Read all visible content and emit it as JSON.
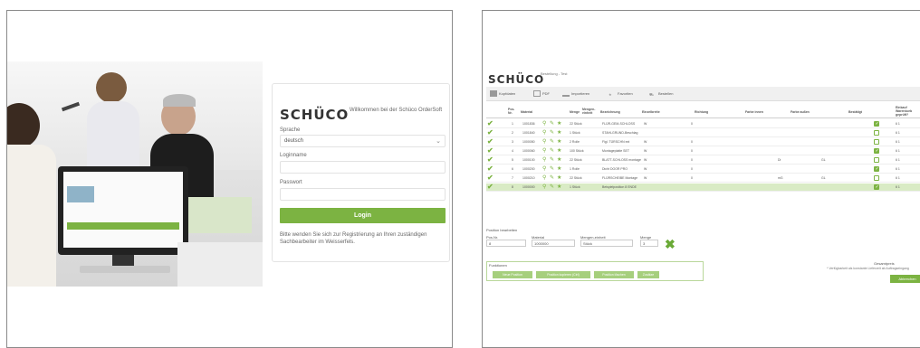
{
  "login": {
    "logo": "SCHÜCO",
    "welcome": "Willkommen bei der Schüco OrderSoft",
    "language_label": "Sprache",
    "language_value": "deutsch",
    "username_label": "Loginname",
    "password_label": "Passwort",
    "login_button": "Login",
    "help_text": "Bitte wenden Sie sich zur Registrierung an Ihren zuständigen Sachbearbeiter im Weisserfels.",
    "photo_caption": "Teammeeting am Bildschirm"
  },
  "order": {
    "logo": "SCHÜCO",
    "subtitle": "Bestellung - Test",
    "toolbar": [
      "Kopfdaten",
      "PDF",
      "Importieren",
      "Favoriten",
      "Bestellen"
    ],
    "columns": [
      "Pos. Nr.",
      "Material",
      "Menge",
      "Mengen-einheit",
      "Bezeichnung",
      "Einzelbreite",
      "Richtung",
      "Farbe innen",
      "Farbe außen",
      "Bestätigt",
      "Einkauf Warenkorb geprüft?"
    ],
    "rows": [
      {
        "pos": "1",
        "material": "1001836",
        "qty": "22 Stück",
        "desc": "FLÜR-GEM-SCHLOSS",
        "b": "W",
        "c": "0",
        "d": "",
        "e": "",
        "checked": true,
        "end": "6 1"
      },
      {
        "pos": "2",
        "material": "1001840",
        "qty": "1 Stück",
        "desc": "STAHLGRUND-Beschlag",
        "b": "",
        "c": "",
        "d": "",
        "e": "",
        "checked": false,
        "end": "6 1"
      },
      {
        "pos": "3",
        "material": "1000050",
        "qty": "2 Rolle",
        "desc": "Flgl. TÜRSCHN ext",
        "b": "W",
        "c": "0",
        "d": "",
        "e": "",
        "checked": false,
        "end": "6 1"
      },
      {
        "pos": "4",
        "material": "1000060",
        "qty": "100 Stück",
        "desc": "Montageplatte SET",
        "b": "W",
        "c": "0",
        "d": "",
        "e": "",
        "checked": true,
        "end": "6 1"
      },
      {
        "pos": "5",
        "material": "1000100",
        "qty": "22 Stück",
        "desc": "BLATT-SCHLOSS montage",
        "b": "W",
        "c": "0",
        "d": "Di",
        "e": "GL",
        "checked": false,
        "end": "6 1"
      },
      {
        "pos": "6",
        "material": "1000200",
        "qty": "1 Rolle",
        "desc": "Dicht DOOR PRO",
        "b": "W",
        "c": "0",
        "d": "",
        "e": "",
        "checked": true,
        "end": "6 1"
      },
      {
        "pos": "7",
        "material": "1000210",
        "qty": "22 Stück",
        "desc": "FLÜRSCHEIBE Montage",
        "b": "W",
        "c": "0",
        "d": "mG",
        "e": "GL",
        "checked": false,
        "end": "6 1"
      },
      {
        "pos": "8",
        "material": "1000000",
        "qty": "1 Stück",
        "desc": "Beispielposition 8 ENDE",
        "b": "",
        "c": "",
        "d": "",
        "e": "",
        "checked": true,
        "end": "6 1",
        "selected": true
      }
    ],
    "edit_title": "Position bearbeiten",
    "edit_labels": [
      "Pos.Nr.",
      "Material",
      "Mengen-einheit",
      "Menge"
    ],
    "edit_values": [
      "8",
      "1000000",
      "Stück",
      "3"
    ],
    "func_title": "Funktionen",
    "func_buttons": [
      "Neue Position",
      "Position kopieren (Ctrl)",
      "Position löschen",
      "Zusätze"
    ],
    "total_label": "Gesamtpreis",
    "note": "* Verfügbarkeit als konstante Lieferzeit ab Auftragseingang",
    "order_button": "Abbrechen"
  }
}
